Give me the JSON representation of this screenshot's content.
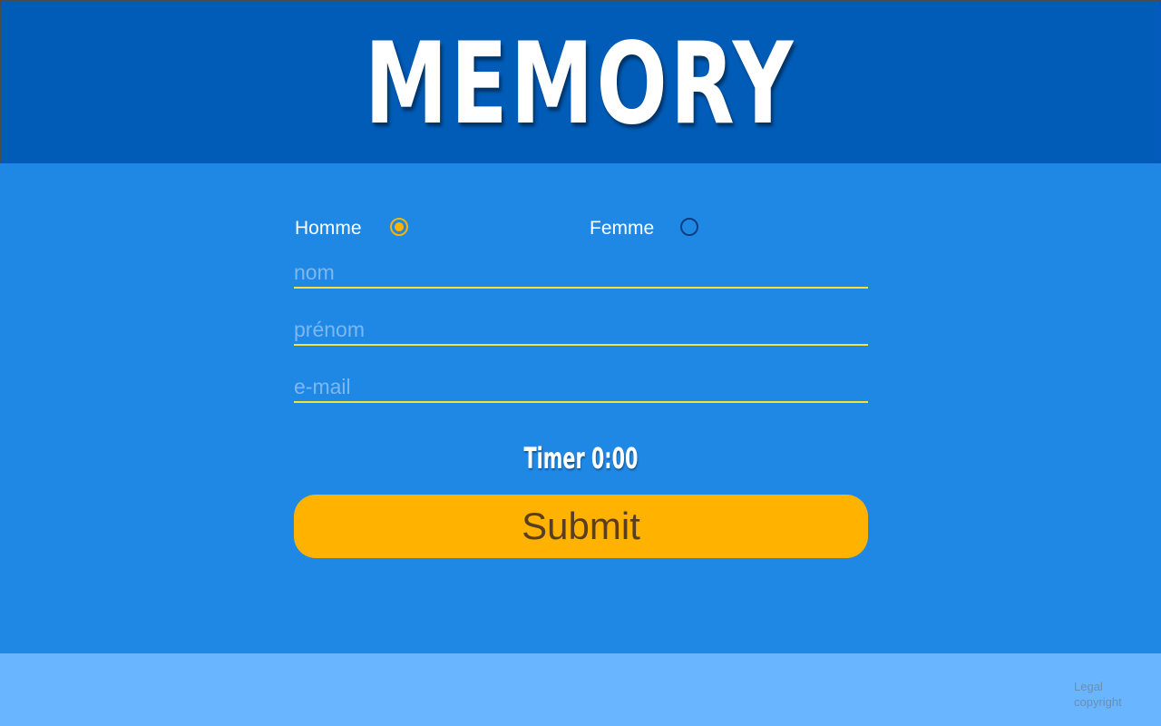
{
  "header": {
    "logo_text": "memory"
  },
  "form": {
    "gender": {
      "male_label": "Homme",
      "female_label": "Femme",
      "selected": "Homme"
    },
    "fields": {
      "last_name_placeholder": "nom",
      "first_name_placeholder": "prénom",
      "email_placeholder": "e-mail"
    },
    "timer_text": "Timer 0:00",
    "submit_label": "Submit"
  },
  "footer": {
    "links": [
      "Legal",
      "copyright"
    ]
  },
  "colors": {
    "header_bg": "#005cb7",
    "main_bg": "#1f88e5",
    "footer_bg": "#69b5ff",
    "accent": "#ffb300",
    "input_underline": "#f5e23a"
  }
}
